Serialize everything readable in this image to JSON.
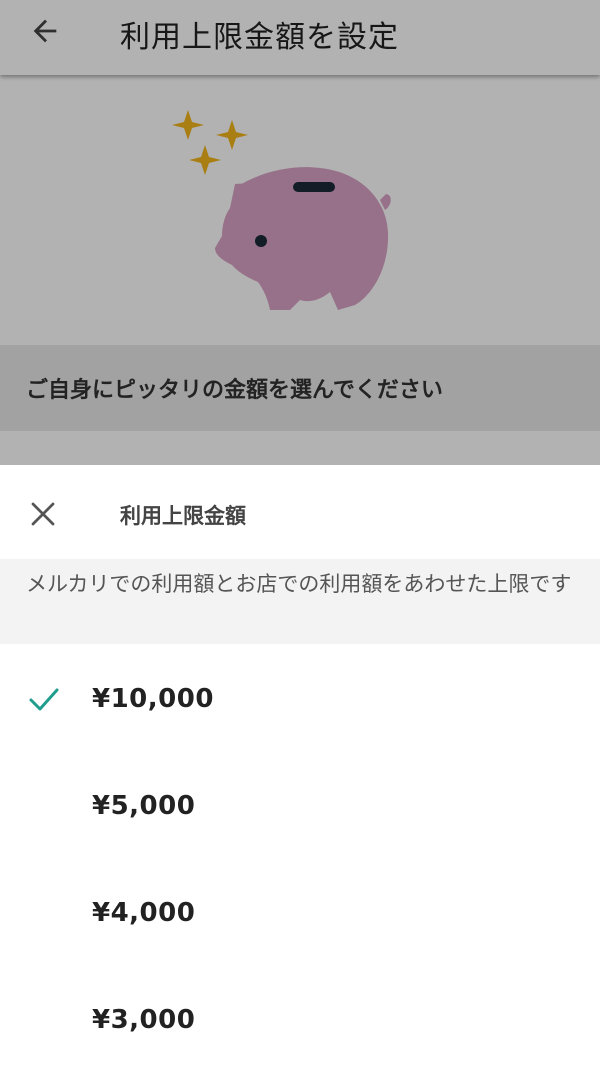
{
  "appbar": {
    "title": "利用上限金額を設定"
  },
  "hero": {
    "illustration": "piggy-bank-with-sparkles"
  },
  "band": {
    "text": "ご自身にピッタリの金額を選んでください"
  },
  "sheet": {
    "title": "利用上限金額",
    "notice": "メルカリでの利用額とお店での利用額をあわせた上限です",
    "options": [
      {
        "label": "¥10,000",
        "selected": true
      },
      {
        "label": "¥5,000",
        "selected": false
      },
      {
        "label": "¥4,000",
        "selected": false
      },
      {
        "label": "¥3,000",
        "selected": false
      }
    ]
  },
  "colors": {
    "check": "#1f9e8e",
    "pig": "#d9a3c5",
    "sparkle": "#f2b51c",
    "scrim": "rgba(0,0,0,0.30)"
  }
}
